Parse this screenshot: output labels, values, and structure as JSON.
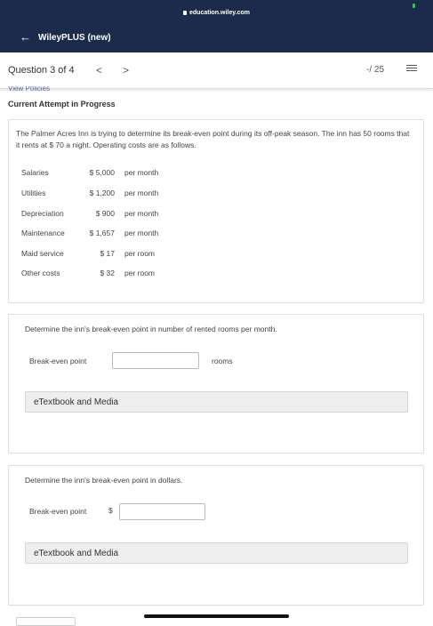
{
  "browser": {
    "url": "education.wiley.com"
  },
  "app": {
    "title": "WileyPLUS (new)"
  },
  "question_nav": {
    "label": "Question 3 of 4",
    "prev": "<",
    "next": ">",
    "score": "-/ 25"
  },
  "partial_link": "View Policies",
  "attempt_status": "Current Attempt in Progress",
  "problem": {
    "text": "The Palmer Acres Inn is trying to determine its break-even point during its off-peak season. The inn has 50 rooms that it rents at $ 70  a night. Operating costs are as follows.",
    "costs": [
      {
        "label": "Salaries",
        "amount": "$ 5,000",
        "unit": "per month"
      },
      {
        "label": "Utilities",
        "amount": "$ 1,200",
        "unit": "per month"
      },
      {
        "label": "Depreciation",
        "amount": "$ 900",
        "unit": "per month"
      },
      {
        "label": "Maintenance",
        "amount": "$ 1,657",
        "unit": "per month"
      },
      {
        "label": "Maid service",
        "amount": "$ 17",
        "unit": "per room"
      },
      {
        "label": "Other costs",
        "amount": "$ 32",
        "unit": "per room"
      }
    ]
  },
  "part1": {
    "question": "Determine the inn's break-even point in number of rented rooms per month.",
    "field_label": "Break-even point",
    "value": "",
    "unit": "rooms",
    "etext": "eTextbook and Media"
  },
  "part2": {
    "question": "Determine the inn's break-even point in dollars.",
    "field_label": "Break-even point",
    "prefix": "$",
    "value": "",
    "etext": "eTextbook and Media"
  }
}
